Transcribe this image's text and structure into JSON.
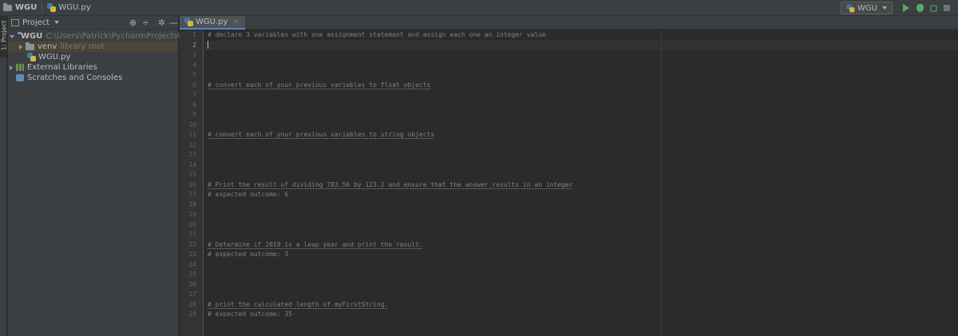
{
  "navbar": {
    "project": "WGU",
    "file": "WGU.py",
    "run_config": "WGU"
  },
  "left_strip": {
    "project_tab": "1: Project"
  },
  "project_pane": {
    "title": "Project",
    "tree": [
      {
        "name": "WGU",
        "path": "C:\\Users\\Patrick\\PycharmProjects\\WGU"
      },
      {
        "name": "venv",
        "note": "library root"
      },
      {
        "name": "WGU.py"
      },
      {
        "name": "External Libraries"
      },
      {
        "name": "Scratches and Consoles"
      }
    ]
  },
  "editor": {
    "tab_label": "WGU.py",
    "active_line": 2,
    "line_numbers": [
      "1",
      "2",
      "3",
      "4",
      "5",
      "6",
      "7",
      "8",
      "9",
      "10",
      "11",
      "12",
      "13",
      "14",
      "15",
      "16",
      "17",
      "18",
      "19",
      "20",
      "21",
      "22",
      "23",
      "24",
      "25",
      "26",
      "27",
      "28",
      "29"
    ],
    "lines": [
      "# declare 3 variables with one assignment statement and assign each one an integer value",
      "",
      "",
      "",
      "",
      "# convert each of your previous variables to float objects",
      "",
      "",
      "",
      "",
      "# convert each of your previous variables to string objects",
      "",
      "",
      "",
      "",
      "# Print the result of dividing 783.56 by 123.2 and ensure that the answer results in an integer",
      "# expected outcome: 6",
      "",
      "",
      "",
      "",
      "# Determine if 2019 is a leap year and print the result.",
      "# expected outcome: 3",
      "",
      "",
      "",
      "",
      "# print the calculated length of myFirstString.",
      "# expected outcome: 35"
    ]
  },
  "icons": {
    "folder": "folder-icon",
    "python_file": "python-file-icon",
    "run": "run-icon",
    "debug": "debug-icon",
    "coverage": "coverage-icon",
    "stop": "stop-icon",
    "locate": "locate-icon",
    "collapse": "collapse-icon",
    "settings": "gear-icon",
    "hide": "minimize-icon"
  },
  "colors": {
    "editor_bg": "#2b2b2b",
    "panel_bg": "#3c3f41",
    "comment": "#808080",
    "run_green": "#59a869",
    "tab_accent": "#4a88c7"
  }
}
